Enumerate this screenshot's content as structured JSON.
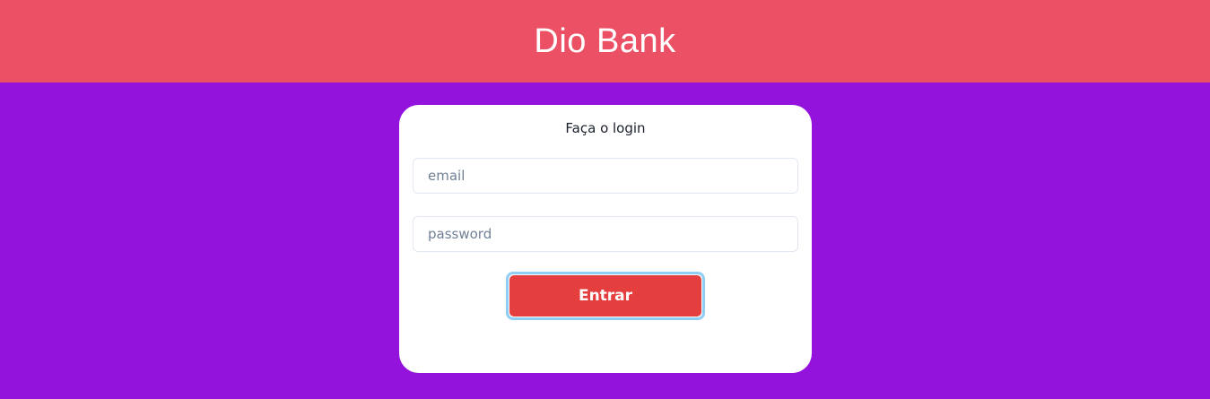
{
  "header": {
    "title": "Dio Bank"
  },
  "login": {
    "title": "Faça o login",
    "email_placeholder": "email",
    "email_value": "",
    "password_placeholder": "password",
    "password_value": "",
    "submit_label": "Entrar"
  },
  "colors": {
    "background": "#9413dc",
    "header": "#ec5064",
    "card": "#ffffff",
    "button": "#e53e3e",
    "focus_ring": "#90cdf4"
  }
}
